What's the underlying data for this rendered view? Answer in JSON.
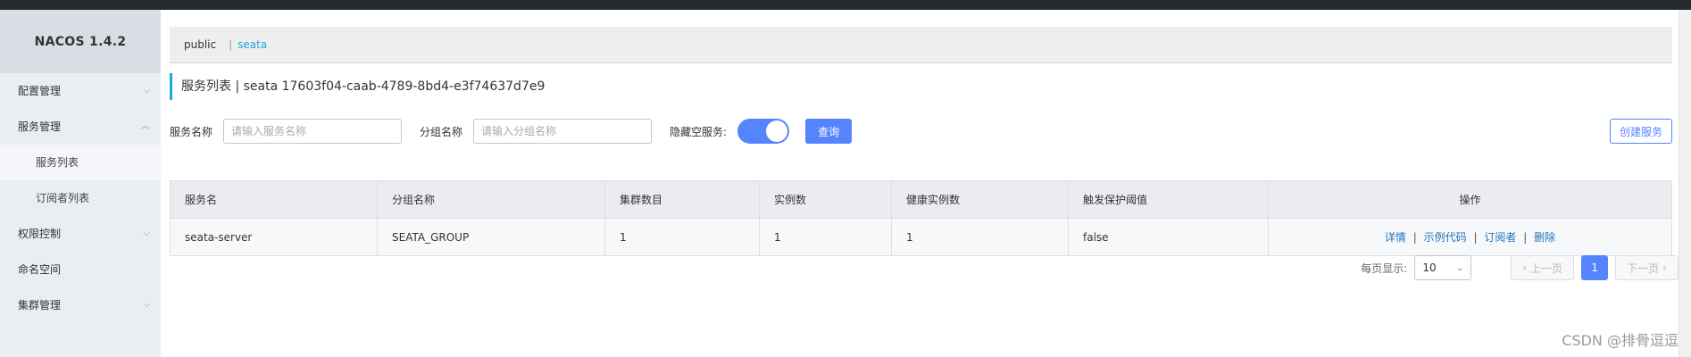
{
  "app": {
    "title": "NACOS 1.4.2"
  },
  "sidebar": {
    "items": [
      {
        "label": "配置管理",
        "chevron": "⌵"
      },
      {
        "label": "服务管理",
        "chevron": "︿"
      },
      {
        "label": "服务列表"
      },
      {
        "label": "订阅者列表"
      },
      {
        "label": "权限控制",
        "chevron": "⌵"
      },
      {
        "label": "命名空间"
      },
      {
        "label": "集群管理",
        "chevron": "⌵"
      }
    ]
  },
  "breadcrumb": {
    "ns1": "public",
    "sep": "|",
    "ns2": "seata"
  },
  "page": {
    "title": "服务列表  |  seata  17603f04-caab-4789-8bd4-e3f74637d7e9"
  },
  "filter": {
    "service_label": "服务名称",
    "service_placeholder": "请输入服务名称",
    "group_label": "分组名称",
    "group_placeholder": "请输入分组名称",
    "hide_empty_label": "隐藏空服务:",
    "search_button": "查询",
    "create_button": "创建服务"
  },
  "table": {
    "headers": [
      "服务名",
      "分组名称",
      "集群数目",
      "实例数",
      "健康实例数",
      "触发保护阈值",
      "操作"
    ],
    "rows": [
      {
        "name": "seata-server",
        "group": "SEATA_GROUP",
        "clusters": "1",
        "instances": "1",
        "healthy": "1",
        "protect": "false"
      }
    ],
    "actions": [
      "详情",
      "示例代码",
      "订阅者",
      "删除"
    ],
    "action_sep": "|"
  },
  "pagination": {
    "page_size_label": "每页显示:",
    "page_size": "10",
    "prev": "上一页",
    "next": "下一页",
    "current": "1"
  },
  "watermark": "CSDN @排骨逗逗",
  "colors": {
    "accent": "#5584ff",
    "link": "#1e73b9",
    "highlight": "#1ea7dd",
    "sidebar_bg": "#eaedf1"
  }
}
